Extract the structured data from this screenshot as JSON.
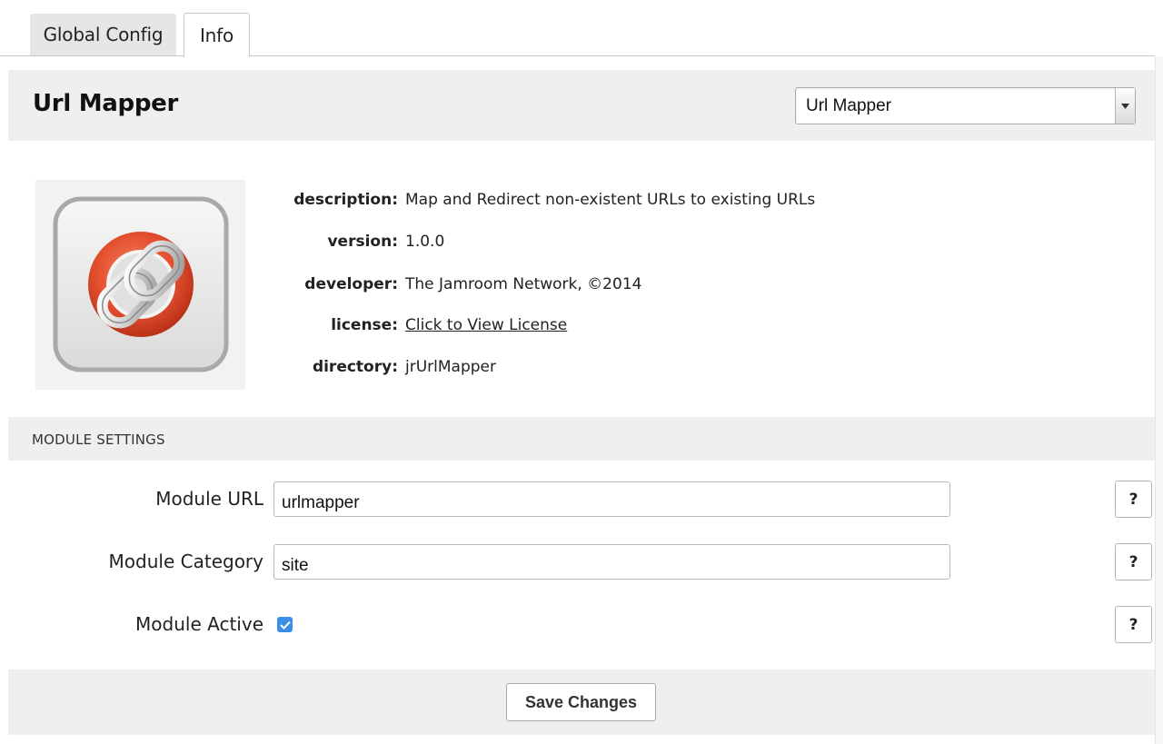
{
  "tabs": [
    {
      "label": "Global Config"
    },
    {
      "label": "Info"
    }
  ],
  "header": {
    "title": "Url Mapper",
    "module_select": {
      "selected": "Url Mapper"
    }
  },
  "module_info": {
    "icon": "chain-link-icon",
    "rows": [
      {
        "label": "description:",
        "value": "Map and Redirect non-existent URLs to existing URLs"
      },
      {
        "label": "version:",
        "value": "1.0.0"
      },
      {
        "label": "developer:",
        "value": "The Jamroom Network, ©2014"
      },
      {
        "label": "license:",
        "value": "Click to View License"
      },
      {
        "label": "directory:",
        "value": "jrUrlMapper"
      }
    ]
  },
  "settings": {
    "section_title": "MODULE SETTINGS",
    "module_url": {
      "label": "Module URL",
      "value": "urlmapper"
    },
    "module_category": {
      "label": "Module Category",
      "value": "site"
    },
    "module_active": {
      "label": "Module Active",
      "checked": true
    },
    "help_label": "?"
  },
  "footer": {
    "save_label": "Save Changes"
  },
  "colors": {
    "checkbox": "#3b8ee8",
    "panel_bg": "#efefef"
  }
}
